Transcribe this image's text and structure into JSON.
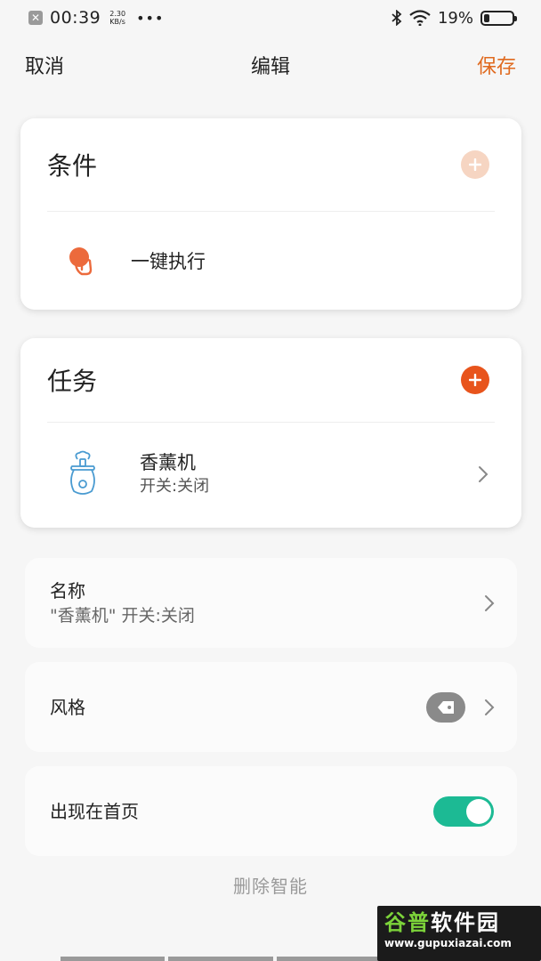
{
  "statusbar": {
    "time": "00:39",
    "speed_value": "2.30",
    "speed_unit": "KB/s",
    "more": "•••",
    "battery": "19%",
    "battery_level": 0.19,
    "notif_icon": "close-notification-icon"
  },
  "nav": {
    "cancel": "取消",
    "title": "编辑",
    "save": "保存"
  },
  "conditions": {
    "title": "条件",
    "item_label": "一键执行"
  },
  "tasks": {
    "title": "任务",
    "items": [
      {
        "name": "香薰机",
        "sub": "开关:关闭"
      }
    ]
  },
  "settings": {
    "name_label": "名称",
    "name_value": "\"香薰机\" 开关:关闭",
    "style_label": "风格",
    "homepage_label": "出现在首页",
    "homepage_on": true
  },
  "delete_label": "删除智能",
  "watermark": {
    "logo_a": "谷普",
    "logo_b": "软件园",
    "url": "www.gupuxiazai.com"
  },
  "colors": {
    "accent": "#e06a1f",
    "plus_active": "#e8541c",
    "plus_disabled": "#f6d5c2",
    "toggle_on": "#1cba94"
  }
}
